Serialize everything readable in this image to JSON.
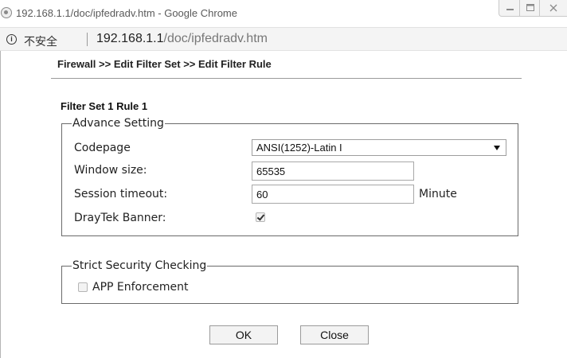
{
  "window": {
    "title": "192.168.1.1/doc/ipfedradv.htm - Google Chrome",
    "browser_icon": "chrome-icon",
    "controls": [
      "minimize-icon",
      "maximize-icon",
      "close-icon"
    ]
  },
  "addressbar": {
    "security_label": "不安全",
    "url_host": "192.168.1.1",
    "url_path": "/doc/ipfedradv.htm"
  },
  "page": {
    "breadcrumb": "Firewall >> Edit Filter Set >> Edit Filter Rule",
    "section_title": "Filter Set 1 Rule 1"
  },
  "advance": {
    "legend": "Advance Setting",
    "codepage_label": "Codepage",
    "codepage_value": "ANSI(1252)-Latin I",
    "window_size_label": "Window size:",
    "window_size_value": "65535",
    "session_timeout_label": "Session timeout:",
    "session_timeout_value": "60",
    "session_timeout_unit": "Minute",
    "banner_label": "DrayTek Banner:",
    "banner_checked": true
  },
  "strict": {
    "legend": "Strict Security Checking",
    "app_enforcement_label": "APP Enforcement",
    "app_enforcement_checked": false
  },
  "buttons": {
    "ok": "OK",
    "close": "Close"
  }
}
